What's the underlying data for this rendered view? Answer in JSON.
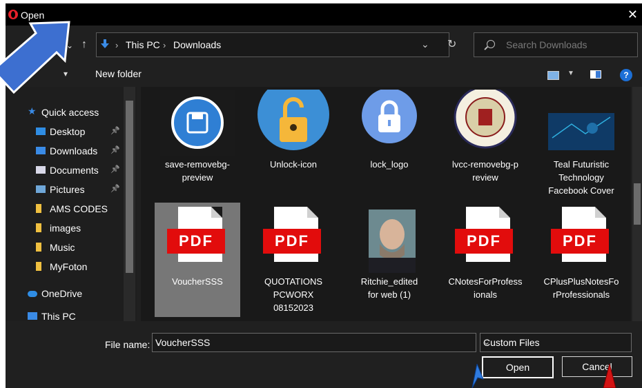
{
  "window": {
    "title": "Open"
  },
  "nav": {
    "back": "←",
    "forward": "→",
    "recent": "⌄",
    "up": "↑",
    "breadcrumb": [
      "This PC",
      "Downloads"
    ],
    "search_placeholder": "Search Downloads"
  },
  "toolbar": {
    "organize": "▾",
    "new_folder": "New folder",
    "help": "?"
  },
  "sidebar": {
    "items": [
      {
        "label": "Quick access",
        "icon": "star-icon",
        "pinned": false
      },
      {
        "label": "Desktop",
        "icon": "desktop-icon",
        "pinned": true
      },
      {
        "label": "Downloads",
        "icon": "download-icon",
        "pinned": true
      },
      {
        "label": "Documents",
        "icon": "documents-icon",
        "pinned": true
      },
      {
        "label": "Pictures",
        "icon": "pictures-icon",
        "pinned": true
      },
      {
        "label": "AMS CODES",
        "icon": "folder-icon",
        "pinned": false
      },
      {
        "label": "images",
        "icon": "folder-icon",
        "pinned": false
      },
      {
        "label": "Music",
        "icon": "folder-icon",
        "pinned": false
      },
      {
        "label": "MyFoton",
        "icon": "folder-icon",
        "pinned": false
      },
      {
        "label": "OneDrive",
        "icon": "cloud-icon",
        "pinned": false
      },
      {
        "label": "This PC",
        "icon": "pc-icon",
        "pinned": false
      }
    ]
  },
  "files": [
    {
      "name": "save-removebg-preview",
      "lines": [
        "save-removebg-",
        "preview"
      ],
      "kind": "image-save"
    },
    {
      "name": "Unlock-icon",
      "lines": [
        "Unlock-icon"
      ],
      "kind": "image-unlock"
    },
    {
      "name": "lock_logo",
      "lines": [
        "lock_logo"
      ],
      "kind": "image-lock"
    },
    {
      "name": "lvcc-removebg-preview",
      "lines": [
        "lvcc-removebg-p",
        "review"
      ],
      "kind": "image-seal"
    },
    {
      "name": "Teal Futuristic Technology Facebook Cover",
      "lines": [
        "Teal Futuristic",
        "Technology",
        "Facebook Cover"
      ],
      "kind": "image-tech"
    },
    {
      "name": "VoucherSSS",
      "lines": [
        "VoucherSSS"
      ],
      "kind": "pdf",
      "selected": true
    },
    {
      "name": "QUOTATIONS PCWORX 08152023",
      "lines": [
        "QUOTATIONS",
        "PCWORX",
        "08152023"
      ],
      "kind": "pdf"
    },
    {
      "name": "Ritchie_edited for web (1)",
      "lines": [
        "Ritchie_edited",
        "for web (1)"
      ],
      "kind": "image-photo"
    },
    {
      "name": "CNotesForProfessionals",
      "lines": [
        "CNotesForProfess",
        "ionals"
      ],
      "kind": "pdf"
    },
    {
      "name": "CPlusPlusNotesForProfessionals",
      "lines": [
        "CPlusPlusNotesFo",
        "rProfessionals"
      ],
      "kind": "pdf"
    }
  ],
  "pdf_badge": "PDF",
  "bottom": {
    "file_name_label": "File name:",
    "file_name_value": "VoucherSSS",
    "file_type": "Custom Files",
    "open_label": "Open",
    "cancel_label": "Cancel"
  },
  "colors": {
    "accent": "#1c6fd6",
    "pdf_red": "#e20c0c",
    "background": "#202020"
  }
}
